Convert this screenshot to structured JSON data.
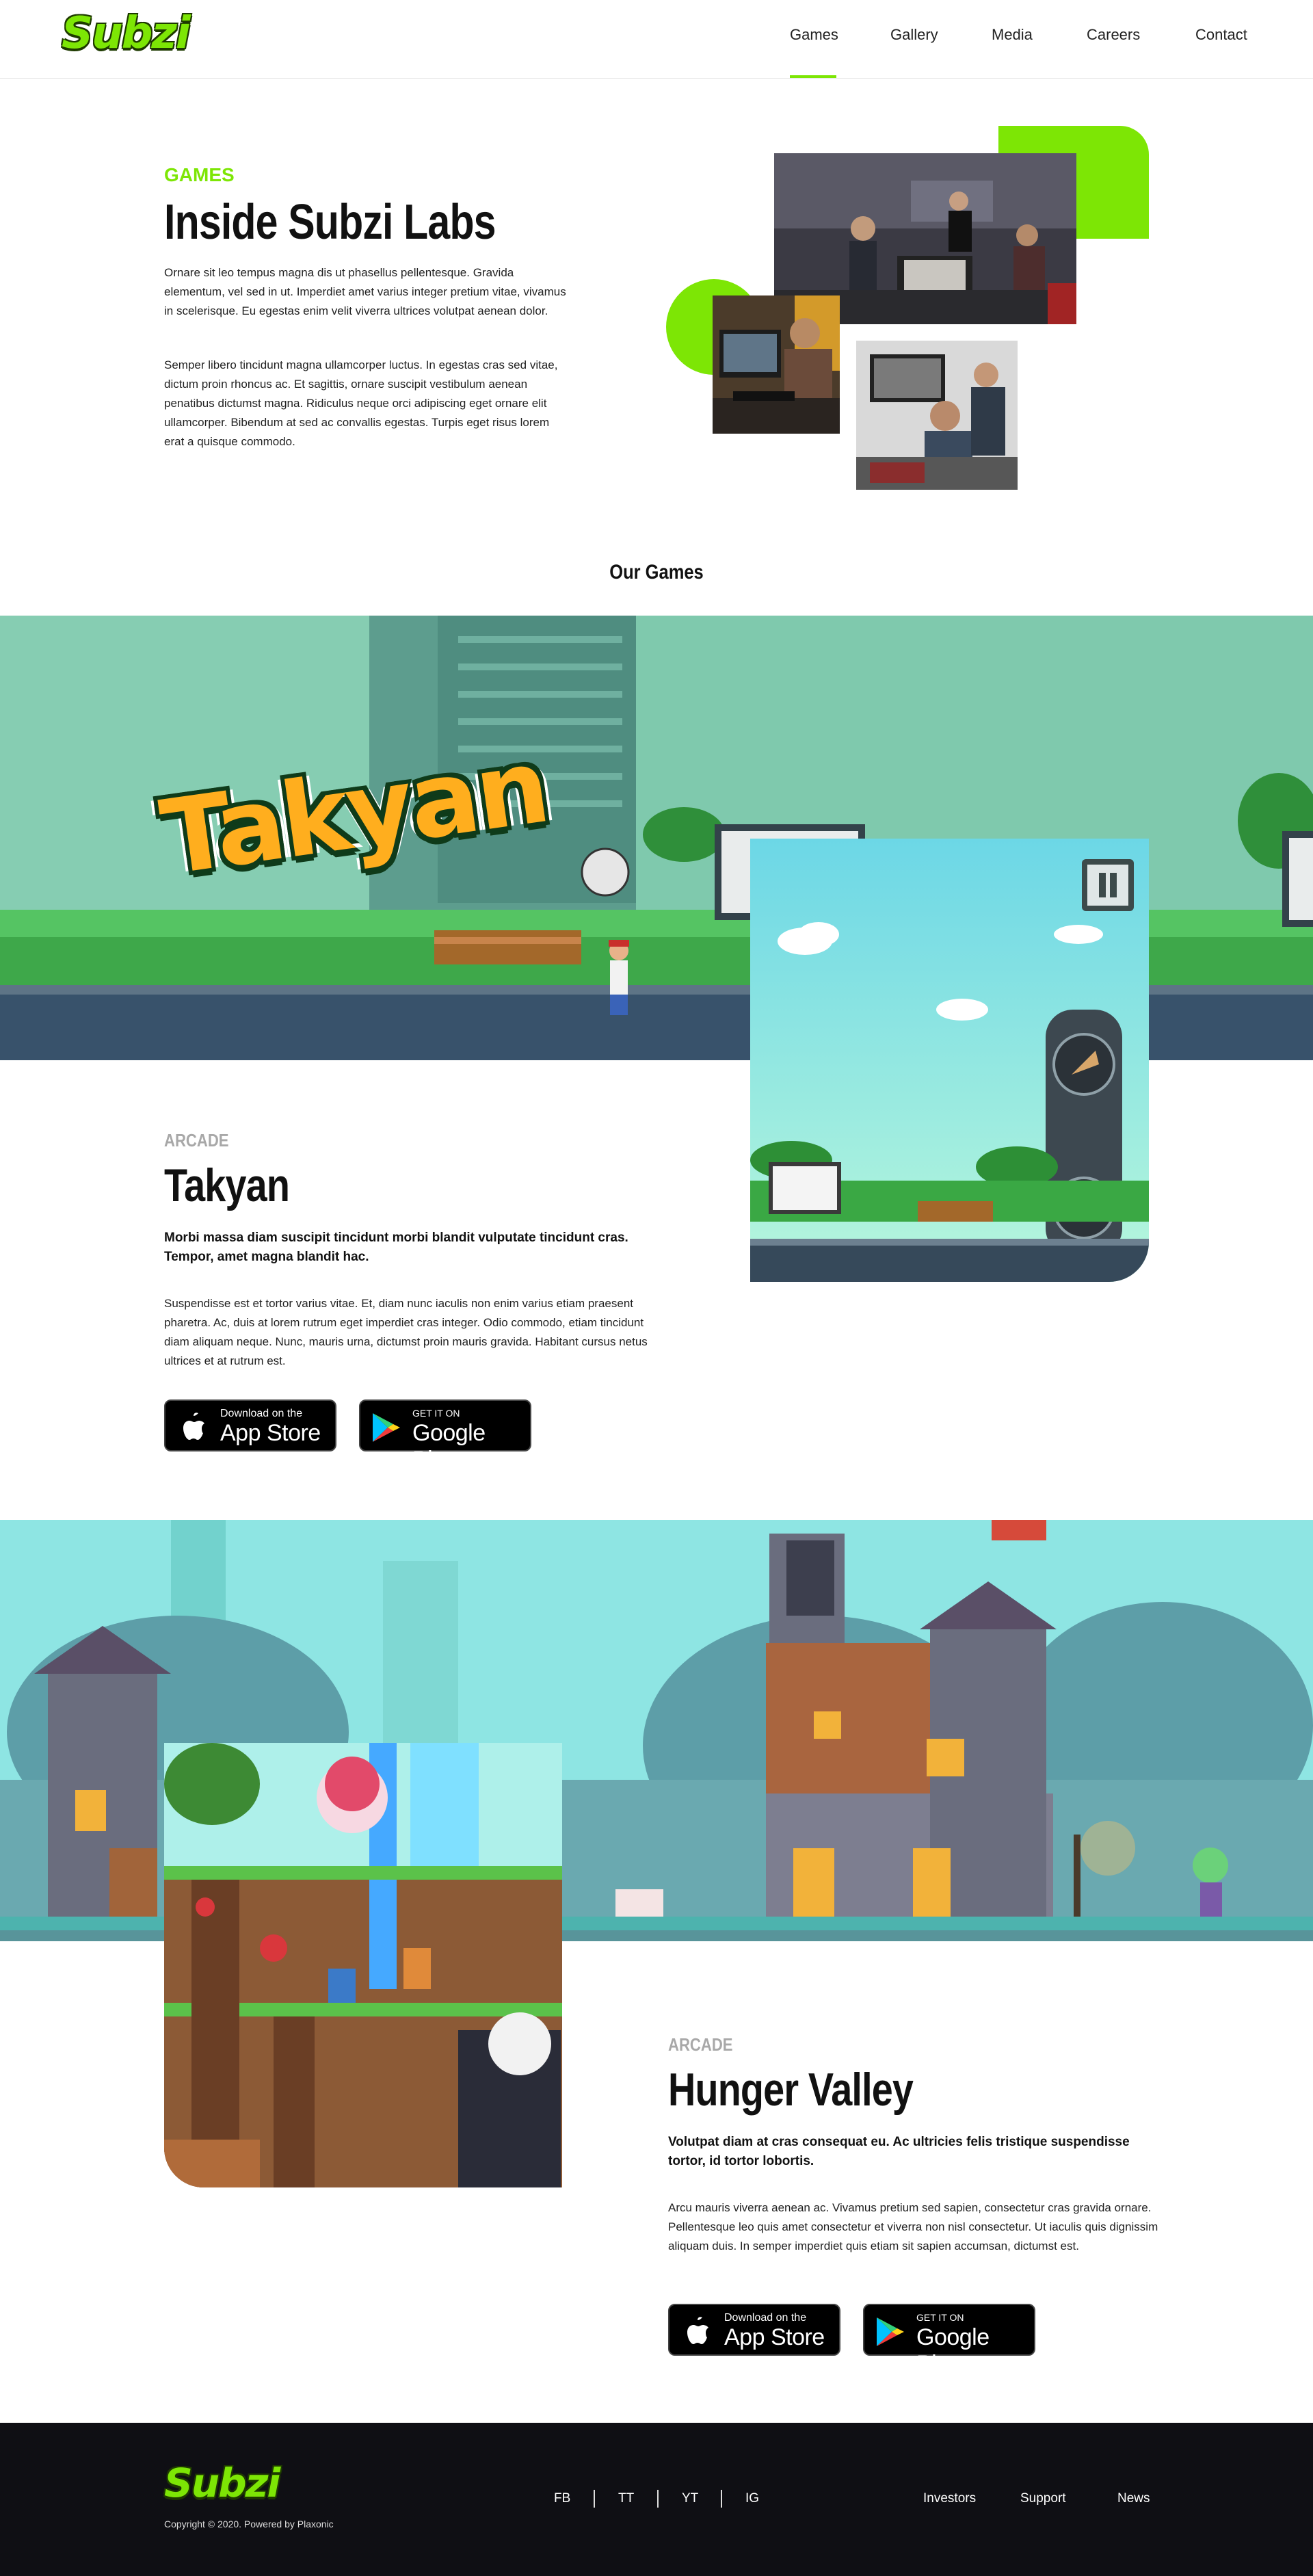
{
  "header": {
    "logo": "Subzi",
    "nav": [
      {
        "label": "Games",
        "active": true
      },
      {
        "label": "Gallery"
      },
      {
        "label": "Media"
      },
      {
        "label": "Careers"
      },
      {
        "label": "Contact"
      }
    ]
  },
  "about": {
    "kicker": "GAMES",
    "title": "Inside Subzi Labs",
    "para1": "Ornare sit leo tempus magna dis ut phasellus pellentesque. Gravida elementum, vel sed in ut. Imperdiet amet varius integer pretium vitae, vivamus in scelerisque. Eu egestas enim velit viverra ultrices volutpat aenean dolor.",
    "para2": "Semper libero tincidunt magna ullamcorper luctus. In egestas cras sed vitae, dictum proin rhoncus ac. Et sagittis, ornare suscipit vestibulum aenean penatibus dictumst magna. Ridiculus neque orci adipiscing eget ornare elit ullamcorper. Bibendum at sed ac convallis egestas. Turpis eget risus lorem erat a quisque commodo."
  },
  "games_heading": "Our Games",
  "games": [
    {
      "banner_title": "Takyan",
      "category": "ARCADE",
      "title": "Takyan",
      "lead": "Morbi massa diam suscipit tincidunt morbi blandit vulputate tincidunt cras. Tempor, amet magna blandit hac.",
      "body": "Suspendisse est et tortor varius vitae. Et, diam nunc iaculis non enim varius etiam praesent pharetra. Ac, duis at lorem rutrum eget imperdiet cras integer. Odio commodo, etiam tincidunt diam aliquam neque. Nunc, mauris urna, dictumst proin mauris gravida. Habitant cursus netus ultrices et at rutrum est."
    },
    {
      "category": "ARCADE",
      "title": "Hunger Valley",
      "lead": "Volutpat diam at cras consequat eu. Ac ultricies felis tristique suspendisse tortor, id tortor lobortis.",
      "body": "Arcu mauris viverra aenean ac. Vivamus pretium sed sapien, consectetur cras gravida ornare. Pellentesque leo quis amet consectetur et viverra non nisl consectetur. Ut iaculis quis dignissim aliquam duis. In semper imperdiet quis etiam sit sapien accumsan, dictumst est."
    }
  ],
  "stores": {
    "apple_small": "Download on the",
    "apple_big": "App Store",
    "google_small": "GET IT ON",
    "google_big": "Google Play"
  },
  "footer": {
    "logo": "Subzi",
    "copyright": "Copyright © 2020. Powered by Plaxonic",
    "social": [
      "FB",
      "TT",
      "YT",
      "IG"
    ],
    "links": [
      "Investors",
      "Support",
      "News"
    ]
  },
  "colors": {
    "accent": "#7de605",
    "dark": "#0f0f14",
    "takyan_bg": "#7fc9ad",
    "hunger_sky": "#8ee5e3"
  }
}
